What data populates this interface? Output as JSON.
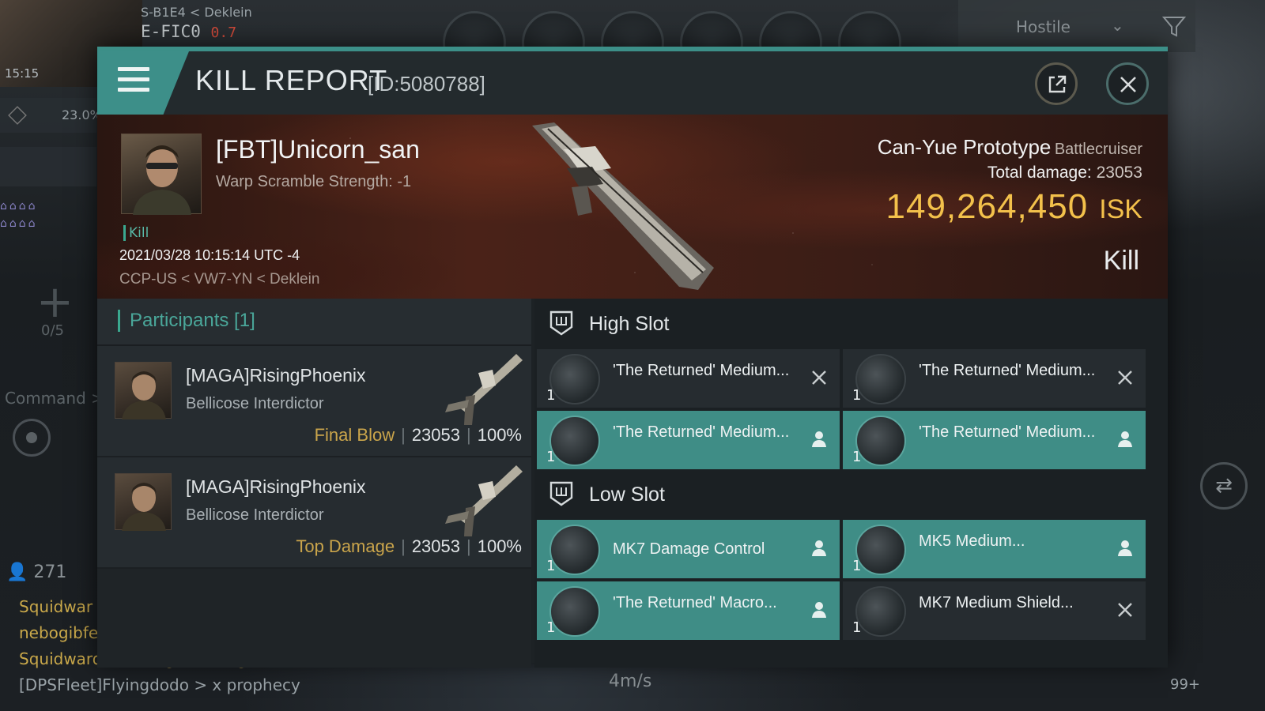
{
  "hud": {
    "system_parent": "S-B1E4",
    "system_region": "< Deklein",
    "system": "E-FIC0",
    "security": "0.7",
    "time": "15:15",
    "cargo": "23.0%",
    "fleet_count": "0/5",
    "command_label": "Command >",
    "local_count": "271",
    "chat": [
      "Squidwar",
      "nebogibfe",
      "Squidward > Fittings:(Armageddon)",
      "[DPSFleet]Flyingdodo > x prophecy"
    ],
    "filter": "Hostile",
    "speed": "4m/s",
    "badge": "99+",
    "target_count": "1"
  },
  "report": {
    "title": "KILL REPORT",
    "id": "[ID:5080788]",
    "victim": {
      "name": "[FBT]Unicorn_san",
      "warp_scramble": "Warp Scramble Strength: -1",
      "tag": "Kill",
      "datetime": "2021/03/28 10:15:14 UTC -4",
      "location": "CCP-US < VW7-YN < Deklein"
    },
    "ship": {
      "name": "Can-Yue Prototype",
      "class": "Battlecruiser",
      "total_damage_label": "Total damage:",
      "total_damage": "23053",
      "isk_value": "149,264,450",
      "isk_unit": "ISK",
      "result": "Kill"
    },
    "participants_label": "Participants [1]",
    "participants": [
      {
        "name": "[MAGA]RisingPhoenix",
        "ship": "Bellicose Interdictor",
        "role": "Final Blow",
        "damage": "23053",
        "percent": "100%"
      },
      {
        "name": "[MAGA]RisingPhoenix",
        "ship": "Bellicose Interdictor",
        "role": "Top Damage",
        "damage": "23053",
        "percent": "100%"
      }
    ],
    "high_slot_label": "High Slot",
    "high_slot": [
      {
        "name": "'The Returned' Medium...",
        "qty": "1",
        "status": "destroyed"
      },
      {
        "name": "'The Returned' Medium...",
        "qty": "1",
        "status": "destroyed"
      },
      {
        "name": "'The Returned' Medium...",
        "qty": "1",
        "status": "dropped"
      },
      {
        "name": "'The Returned' Medium...",
        "qty": "1",
        "status": "dropped"
      }
    ],
    "low_slot_label": "Low Slot",
    "low_slot": [
      {
        "name": "MK7 Damage Control",
        "qty": "1",
        "status": "dropped"
      },
      {
        "name": "MK5 Medium...",
        "qty": "1",
        "status": "dropped"
      },
      {
        "name": "'The Returned' Macro...",
        "qty": "1",
        "status": "dropped"
      },
      {
        "name": "MK7 Medium Shield...",
        "qty": "1",
        "status": "destroyed"
      }
    ]
  },
  "colors": {
    "accent": "#3d8f89",
    "isk": "#f3c14b",
    "role": "#caa54b",
    "security_low": "#d04a3a"
  }
}
